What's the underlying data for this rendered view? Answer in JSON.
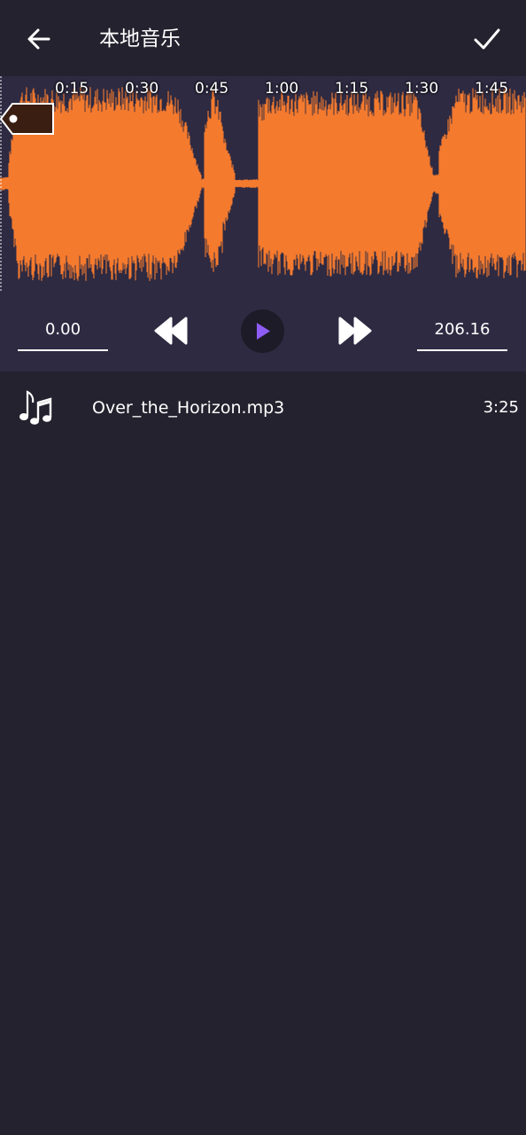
{
  "header": {
    "title": "本地音乐",
    "back_icon": "arrow-left-icon",
    "confirm_icon": "checkmark-icon"
  },
  "editor": {
    "waveform_color": "#f47a2f",
    "timeline": [
      "0:15",
      "0:30",
      "0:45",
      "1:00",
      "1:15",
      "1:30",
      "1:45"
    ],
    "start_time": "0.00",
    "end_time": "206.16",
    "rewind_icon": "rewind-icon",
    "play_icon": "play-icon",
    "play_color": "#8f5cf6",
    "fast_forward_icon": "fast-forward-icon"
  },
  "track": {
    "icon": "music-notes-icon",
    "name": "Over_the_Horizon.mp3",
    "duration": "3:25"
  }
}
